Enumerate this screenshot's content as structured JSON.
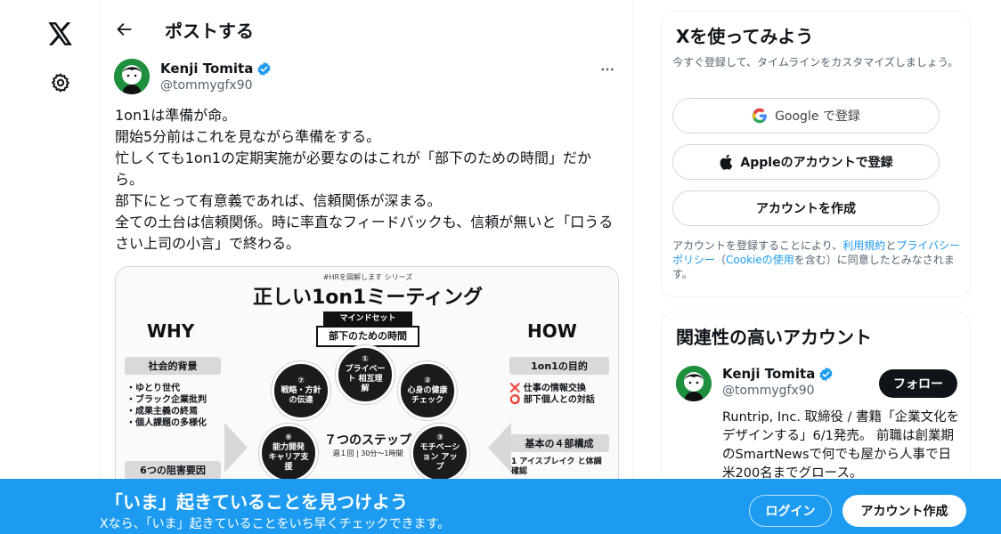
{
  "nav": {
    "logo_icon": "x-logo-icon",
    "settings_icon": "gear-icon"
  },
  "header": {
    "title": "ポストする"
  },
  "post": {
    "author_name": "Kenji Tomita",
    "author_handle": "@tommygfx90",
    "text": "1on1は準備が命。\n開始5分前はこれを見ながら準備をする。\n忙しくても1on1の定期実施が必要なのはこれが「部下のための時間」だから。\n部下にとって有意義であれば、信頼関係が深まる。\n全ての土台は信頼関係。時に率直なフィードバックも、信頼が無いと「口うるさい上司の小言」で終わる。"
  },
  "infographic": {
    "series_tag": "#HRを図解します シリーズ",
    "title": "正しい1on1ミーティング",
    "mindset_label": "マインドセット",
    "mindset_value": "部下のための時間",
    "why": "WHY",
    "how": "HOW",
    "why_box1": "社会的背景",
    "why_list": [
      "・ゆとり世代",
      "・ブラック企業批判",
      "・成果主義の終焉",
      "・個人課題の多様化"
    ],
    "why_box2": "6つの阻害要因",
    "how_box1": "1on1の目的",
    "how_list": [
      "❌ 仕事の情報交換",
      "⭕ 部下個人との対話"
    ],
    "how_box2": "基本の４部構成",
    "how_item": "1 アイスブレイク と体調確認",
    "steps_title": "７つのステップ",
    "steps_sub": "週１回 | 30分〜1時間",
    "steps": [
      {
        "num": "①",
        "label": "プライベート 相互理解"
      },
      {
        "num": "②",
        "label": "心身の健康 チェック"
      },
      {
        "num": "③",
        "label": "モチベーション アップ"
      },
      {
        "num": "⑥",
        "label": "能力開発 キャリア支援"
      },
      {
        "num": "⑦",
        "label": "戦略・方針 の伝達"
      }
    ]
  },
  "sidebar": {
    "signup_title": "Xを使ってみよう",
    "signup_sub": "今すぐ登録して、タイムラインをカスタマイズしましょう。",
    "google_btn": "Google で登録",
    "apple_btn": "Appleのアカウントで登録",
    "create_btn": "アカウントを作成",
    "terms_prefix": "アカウントを登録することにより、",
    "terms_link1": "利用規約",
    "terms_and": "と",
    "terms_link2": "プライバシーポリシー",
    "terms_paren_open": "（",
    "terms_link3": "Cookieの使用",
    "terms_suffix": "を含む）に同意したとみなされます。",
    "related_title": "関連性の高いアカウント",
    "related_name": "Kenji Tomita",
    "related_handle": "@tommygfx90",
    "follow_btn": "フォロー",
    "related_bio": "Runtrip, Inc. 取締役 / 書籍「企業文化をデザインする」6/1発売。 前職は創業期のSmartNewsで何でも屋から人事で日米200名までグロース。"
  },
  "banner": {
    "title": "「いま」起きていることを見つけよう",
    "subtitle": "Xなら、「いま」起きていることをいち早くチェックできます。",
    "login_btn": "ログイン",
    "signup_btn": "アカウント作成"
  },
  "colors": {
    "accent": "#1d9bf0",
    "text": "#0f1419",
    "muted": "#536471",
    "border": "#cfd9de"
  }
}
